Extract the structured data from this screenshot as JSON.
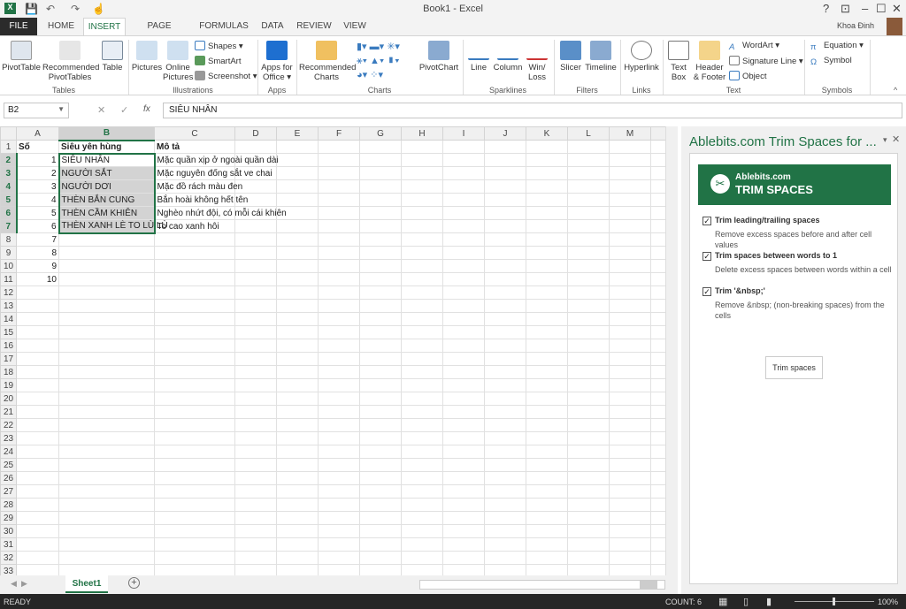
{
  "window": {
    "title": "Book1 - Excel",
    "user": "Khoa Đinh",
    "help": "?",
    "minimize": "–",
    "maximize": "☐",
    "close": "✕"
  },
  "tabs": [
    "FILE",
    "HOME",
    "INSERT",
    "PAGE LAYOUT",
    "FORMULAS",
    "DATA",
    "REVIEW",
    "VIEW"
  ],
  "active_tab": "INSERT",
  "ribbon": {
    "tables": {
      "label": "Tables",
      "pivottable": "PivotTable",
      "recommended": "Recommended PivotTables",
      "table": "Table"
    },
    "illustrations": {
      "label": "Illustrations",
      "pictures": "Pictures",
      "online": "Online Pictures",
      "shapes": "Shapes ▾",
      "smartart": "SmartArt",
      "screenshot": "Screenshot ▾"
    },
    "apps": {
      "label": "Apps",
      "apps_for_office": "Apps for Office ▾"
    },
    "charts": {
      "label": "Charts",
      "recommended": "Recommended Charts",
      "pivotchart": "PivotChart"
    },
    "sparklines": {
      "label": "Sparklines",
      "line": "Line",
      "column": "Column",
      "winloss": "Win/ Loss"
    },
    "filters": {
      "label": "Filters",
      "slicer": "Slicer",
      "timeline": "Timeline"
    },
    "links": {
      "label": "Links",
      "hyperlink": "Hyperlink"
    },
    "text": {
      "label": "Text",
      "textbox": "Text Box",
      "header": "Header & Footer",
      "wordart": "WordArt ▾",
      "signature": "Signature Line ▾",
      "object": "Object"
    },
    "symbols": {
      "label": "Symbols",
      "equation": "Equation ▾",
      "symbol": "Symbol"
    }
  },
  "formula_bar": {
    "name_box": "B2",
    "fx": "fx",
    "value": "SIÊU NHÂN"
  },
  "columns": [
    "A",
    "B",
    "C",
    "D",
    "E",
    "F",
    "G",
    "H",
    "I",
    "J",
    "K",
    "L",
    "M"
  ],
  "selected_column": "B",
  "rows": [
    [
      "Số",
      "Siêu yên hùng",
      "Mô tả"
    ],
    [
      "1",
      "SIÊU NHÂN",
      "Mặc quần xịp ở ngoài quần dài"
    ],
    [
      "2",
      "NGƯỜI SẮT",
      "Mặc nguyên đống sắt ve chai"
    ],
    [
      "3",
      "NGƯỜI DƠI",
      "Mặc đồ rách màu đen"
    ],
    [
      "4",
      "THÈN BẮN CUNG",
      "Bắn hoài không hết tên"
    ],
    [
      "5",
      "THÈN CẦM KHIÊN",
      "Nghèo nhứt đội, có mỗi cái khiên"
    ],
    [
      "6",
      "THÈN XANH LÈ TO LÙ LÙ",
      "To cao xanh hôi"
    ],
    [
      "7",
      "",
      ""
    ],
    [
      "8",
      "",
      ""
    ],
    [
      "9",
      "",
      ""
    ],
    [
      "10",
      "",
      ""
    ]
  ],
  "row_count": 34,
  "selected_rows": [
    2,
    3,
    4,
    5,
    6,
    7
  ],
  "task_pane": {
    "title": "Ablebits.com Trim Spaces for ...",
    "brand": "Ablebits.com",
    "product": "TRIM SPACES",
    "options": [
      {
        "label": "Trim leading/trailing spaces",
        "desc": "Remove excess spaces before and after cell values",
        "checked": true
      },
      {
        "label": "Trim spaces between words to 1",
        "desc": "Delete excess spaces between words within a cell",
        "checked": true
      },
      {
        "label": "Trim '&nbsp;'",
        "desc": "Remove &nbsp; (non-breaking spaces) from the cells",
        "checked": true
      }
    ],
    "button": "Trim spaces"
  },
  "sheets": [
    "Sheet1"
  ],
  "status": {
    "ready": "READY",
    "count": "COUNT: 6",
    "zoom": "100%"
  },
  "colors": {
    "accent": "#217346",
    "file_tab": "#2b2b2b",
    "status_bar": "#262626"
  }
}
